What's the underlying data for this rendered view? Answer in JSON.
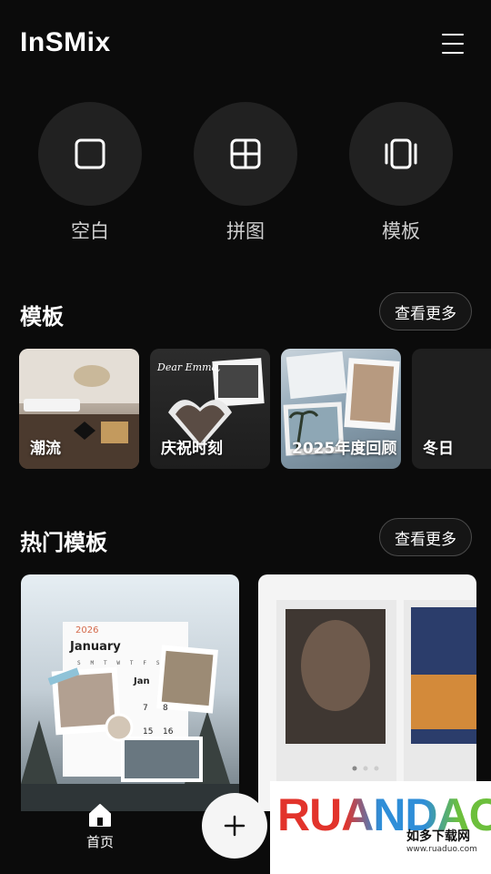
{
  "header": {
    "logo": "InSMix",
    "menu_icon": "hamburger-menu-icon"
  },
  "actions": [
    {
      "label": "空白",
      "icon": "square-icon"
    },
    {
      "label": "拼图",
      "icon": "grid-four-icon"
    },
    {
      "label": "模板",
      "icon": "carousel-icon"
    }
  ],
  "templates": {
    "title": "模板",
    "more_label": "查看更多",
    "items": [
      {
        "label": "潮流"
      },
      {
        "label": "庆祝时刻"
      },
      {
        "label": "2025年度回顾"
      },
      {
        "label": "冬日"
      }
    ]
  },
  "hot_templates": {
    "title": "热门模板",
    "more_label": "查看更多",
    "card1": {
      "year": "2026",
      "month": "Jan",
      "month_full": "January",
      "weekday_letters": [
        "S",
        "M",
        "T",
        "W",
        "T",
        "F",
        "S"
      ],
      "days": [
        "7",
        "8",
        "15",
        "16"
      ]
    }
  },
  "bottom_nav": {
    "home_label": "首页",
    "fab_icon": "plus-icon"
  },
  "watermark": {
    "brand": "RUANDAO",
    "subtitle": "如多下载网",
    "url": "www.ruaduo.com"
  },
  "colors": {
    "background": "#0b0b0b",
    "circle": "#212121",
    "text_secondary": "#cfcfcf"
  }
}
